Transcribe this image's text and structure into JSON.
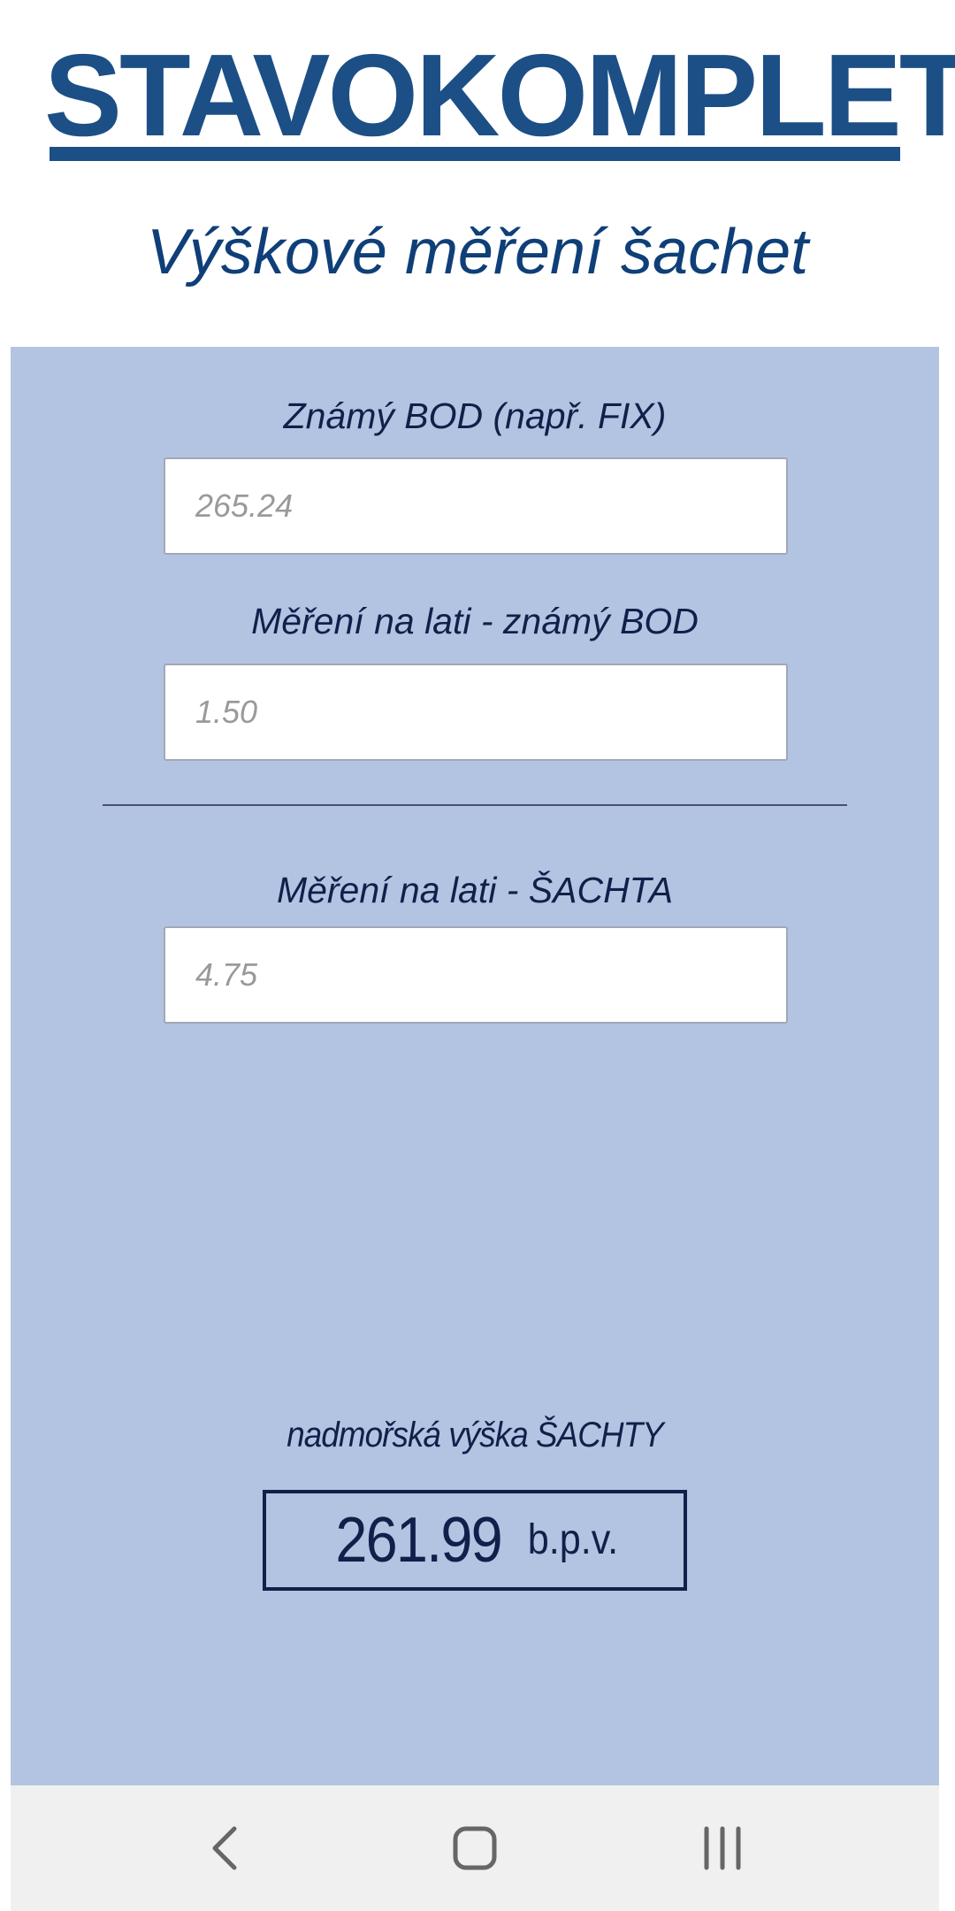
{
  "header": {
    "logo_text": "STAVOKOMPLET",
    "title": "Výškové měření šachet"
  },
  "form": {
    "known_point": {
      "label": "Známý BOD (např. FIX)",
      "placeholder": "265.24",
      "value": ""
    },
    "staff_known_point": {
      "label": "Měření na lati - známý BOD",
      "placeholder": "1.50",
      "value": ""
    },
    "staff_shaft": {
      "label": "Měření na lati - ŠACHTA",
      "placeholder": "4.75",
      "value": ""
    }
  },
  "result": {
    "label": "nadmořská výška ŠACHTY",
    "value": "261.99",
    "unit": "b.p.v."
  },
  "navbar": {
    "icons": [
      "back-icon",
      "home-icon",
      "recent-apps-icon"
    ]
  },
  "colors": {
    "brand_blue": "#1c4f86",
    "title_blue": "#0f3f78",
    "panel_background": "#b3c4e2",
    "text_dark": "#10204a",
    "navbar_background": "#f0f0f0"
  }
}
